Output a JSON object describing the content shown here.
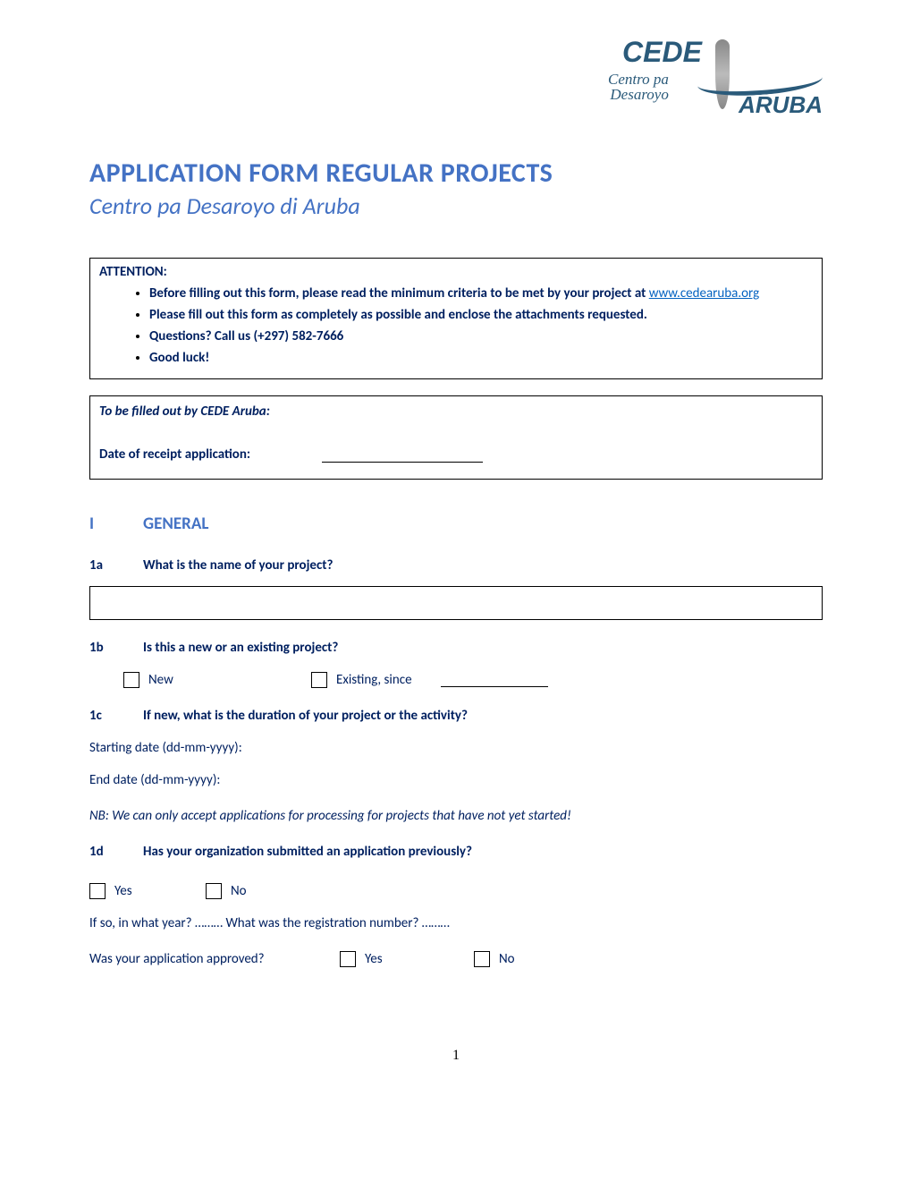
{
  "logo": {
    "line1": "CEDE",
    "line2": "Centro pa",
    "line3": "Desaroyo",
    "line4": "ARUBA"
  },
  "title": "APPLICATION FORM REGULAR PROJECTS",
  "subtitle": "Centro pa Desaroyo di Aruba",
  "attention": {
    "label": "ATTENTION:",
    "items": [
      "Before filling out this form, please read the minimum criteria to be met by your project at ",
      "Please fill out this form as completely as possible and enclose the attachments requested.",
      "Questions? Call us (+297) 582-7666",
      "Good luck!"
    ],
    "link": "www.cedearuba.org"
  },
  "cede_internal": {
    "header": "To be filled out by CEDE Aruba:",
    "date_label": "Date of receipt application:"
  },
  "section1": {
    "num": "I",
    "title": "GENERAL"
  },
  "q1a": {
    "num": "1a",
    "text": "What is the name of your project?"
  },
  "q1b": {
    "num": "1b",
    "text": "Is this a new or an existing project?",
    "opt_new": "New",
    "opt_existing": "Existing, since"
  },
  "q1c": {
    "num": "1c",
    "text": "If new, what is the duration of your project or the activity?",
    "start": "Starting date (dd-mm-yyyy):",
    "end": "End date (dd-mm-yyyy):"
  },
  "note1c": "NB: We can only accept applications for processing for projects that have not yet started!",
  "q1d": {
    "num": "1d",
    "text": "Has your organization submitted an application previously?",
    "yes": "Yes",
    "no": "No",
    "followup": "If so, in what year? ……… What was the registration number? ………",
    "approved_q": "Was your application approved?",
    "approved_yes": "Yes",
    "approved_no": "No"
  },
  "page_number": "1"
}
